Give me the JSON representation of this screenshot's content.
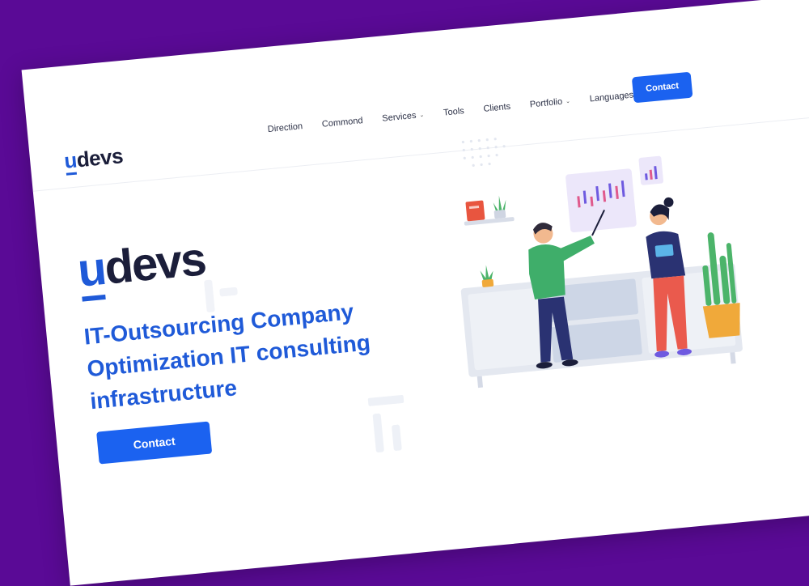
{
  "brand": {
    "logo_u": "u",
    "logo_rest": "devs"
  },
  "nav": {
    "items": [
      {
        "label": "Direction",
        "dropdown": false
      },
      {
        "label": "Commond",
        "dropdown": false
      },
      {
        "label": "Services",
        "dropdown": true
      },
      {
        "label": "Tools",
        "dropdown": false
      },
      {
        "label": "Clients",
        "dropdown": false
      },
      {
        "label": "Portfolio",
        "dropdown": true
      },
      {
        "label": "Languages",
        "dropdown": true
      }
    ],
    "contact_label": "Contact"
  },
  "hero": {
    "logo_u": "u",
    "logo_rest": "devs",
    "lines": [
      "IT-Outsourcing Company",
      "Optimization IT consulting",
      "infrastructure"
    ],
    "contact_label": "Contact"
  },
  "colors": {
    "background": "#5a0a96",
    "accent": "#1b62f0",
    "brand_blue": "#1f5ad8",
    "dark_text": "#1b1e3a"
  },
  "icons": {
    "dropdown": "chevron-down-icon"
  }
}
